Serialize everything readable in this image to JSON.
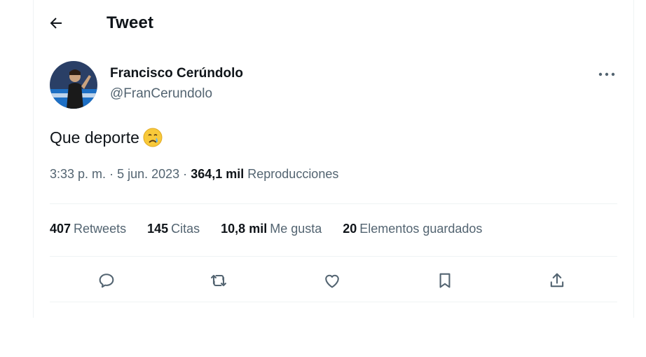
{
  "header": {
    "back_icon": "arrow-left-icon",
    "title": "Tweet"
  },
  "tweet": {
    "author": {
      "name": "Francisco Cerúndolo",
      "handle": "@FranCerundolo",
      "avatar": "avatar-photo"
    },
    "more_icon": "more-horizontal-icon",
    "text": "Que deporte",
    "emoji": "crying-face-emoji",
    "time": "3:33 p. m.",
    "separator": "·",
    "date": "5 jun. 2023",
    "views_count": "364,1 mil",
    "views_label": "Reproducciones"
  },
  "stats": [
    {
      "count": "407",
      "label": "Retweets"
    },
    {
      "count": "145",
      "label": "Citas"
    },
    {
      "count": "10,8 mil",
      "label": "Me gusta"
    },
    {
      "count": "20",
      "label": "Elementos guardados"
    }
  ],
  "actions": [
    {
      "icon": "reply-icon"
    },
    {
      "icon": "retweet-icon"
    },
    {
      "icon": "like-icon"
    },
    {
      "icon": "bookmark-icon"
    },
    {
      "icon": "share-icon"
    }
  ],
  "colors": {
    "text_primary": "#0f1419",
    "text_secondary": "#536471",
    "divider": "#eff3f4",
    "background": "#ffffff"
  }
}
